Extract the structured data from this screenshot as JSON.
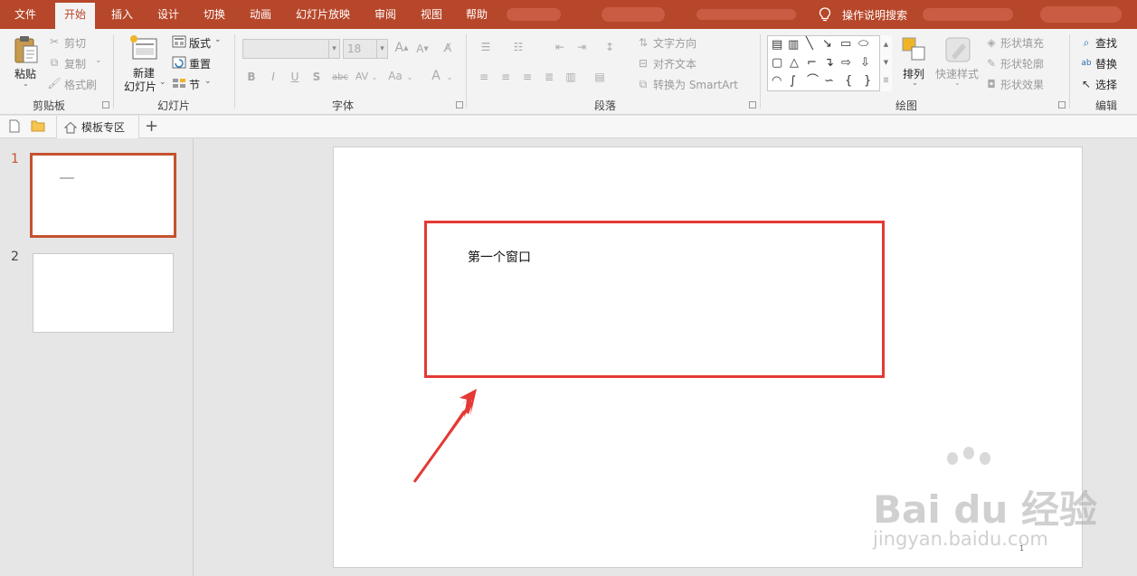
{
  "menu": {
    "items": [
      "文件",
      "开始",
      "插入",
      "设计",
      "切换",
      "动画",
      "幻灯片放映",
      "审阅",
      "视图",
      "帮助"
    ],
    "search": "操作说明搜索"
  },
  "ribbon": {
    "clipboard": {
      "paste": "粘贴",
      "cut": "剪切",
      "copy": "复制",
      "format_painter": "格式刷",
      "label": "剪贴板"
    },
    "slides": {
      "new_slide_line1": "新建",
      "new_slide_line2": "幻灯片",
      "layout": "版式",
      "reset": "重置",
      "section": "节",
      "label": "幻灯片"
    },
    "font": {
      "size": "18",
      "bold": "B",
      "italic": "I",
      "underline": "U",
      "shadow": "S",
      "strike": "abc",
      "spacing": "AV",
      "case": "Aa",
      "grow": "A",
      "shrink": "A",
      "color": "A",
      "label": "字体"
    },
    "paragraph": {
      "text_direction": "文字方向",
      "align_text": "对齐文本",
      "smartart": "转换为 SmartArt",
      "label": "段落"
    },
    "drawing": {
      "arrange": "排列",
      "quick_styles": "快速样式",
      "shape_fill": "形状填充",
      "shape_outline": "形状轮廓",
      "shape_effects": "形状效果",
      "label": "绘图"
    },
    "editing": {
      "find": "查找",
      "replace": "替换",
      "select": "选择",
      "label": "编辑"
    }
  },
  "tabbar": {
    "doc_tab": "模板专区",
    "add": "+"
  },
  "thumbnails": {
    "slide1_num": "1",
    "slide2_num": "2"
  },
  "slide": {
    "text": "第一个窗口",
    "page_number": "1"
  },
  "watermark": {
    "brand": "Bai du 经验",
    "url": "jingyan.baidu.com"
  },
  "colors": {
    "accent": "#b7472a",
    "highlight": "#e53935",
    "arrow": "#e53935"
  }
}
